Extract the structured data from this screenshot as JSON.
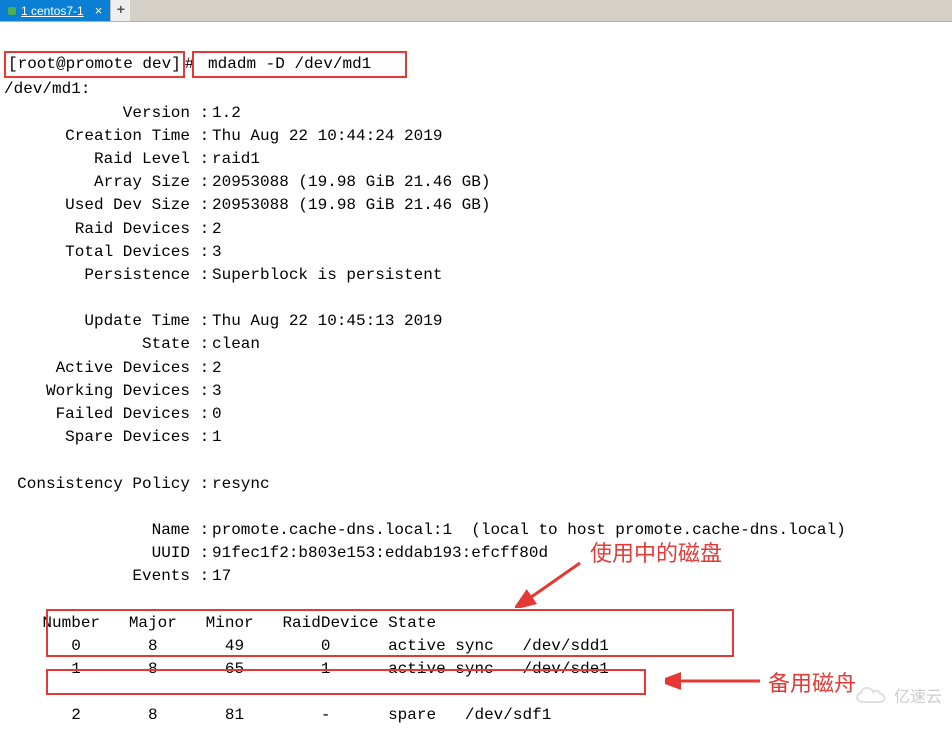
{
  "tab": {
    "label": "1 centos7-1",
    "close": "×",
    "add": "+"
  },
  "prompt": "[root@promote dev]",
  "hash": "#",
  "command": "mdadm -D /dev/md1",
  "device_line": "/dev/md1:",
  "info": {
    "version_k": "Version",
    "version_v": "1.2",
    "creation_time_k": "Creation Time",
    "creation_time_v": "Thu Aug 22 10:44:24 2019",
    "raid_level_k": "Raid Level",
    "raid_level_v": "raid1",
    "array_size_k": "Array Size",
    "array_size_v": "20953088 (19.98 GiB 21.46 GB)",
    "used_dev_size_k": "Used Dev Size",
    "used_dev_size_v": "20953088 (19.98 GiB 21.46 GB)",
    "raid_devices_k": "Raid Devices",
    "raid_devices_v": "2",
    "total_devices_k": "Total Devices",
    "total_devices_v": "3",
    "persistence_k": "Persistence",
    "persistence_v": "Superblock is persistent",
    "update_time_k": "Update Time",
    "update_time_v": "Thu Aug 22 10:45:13 2019",
    "state_k": "State",
    "state_v": "clean",
    "active_devices_k": "Active Devices",
    "active_devices_v": "2",
    "working_devices_k": "Working Devices",
    "working_devices_v": "3",
    "failed_devices_k": "Failed Devices",
    "failed_devices_v": "0",
    "spare_devices_k": "Spare Devices",
    "spare_devices_v": "1",
    "consistency_policy_k": "Consistency Policy",
    "consistency_policy_v": "resync",
    "name_k": "Name",
    "name_v": "promote.cache-dns.local:1  (local to host promote.cache-dns.local)",
    "uuid_k": "UUID",
    "uuid_v": "91fec1f2:b803e153:eddab193:efcff80d",
    "events_k": "Events",
    "events_v": "17"
  },
  "colon": " : ",
  "table_header": "    Number   Major   Minor   RaidDevice State",
  "rows": {
    "r0": "       0       8       49        0      active sync   /dev/sdd1",
    "r1": "       1       8       65        1      active sync   /dev/sde1",
    "r2": "       2       8       81        -      spare   /dev/sdf1"
  },
  "annotations": {
    "in_use": "使用中的磁盘",
    "spare": "备用磁舟"
  },
  "watermark": "亿速云"
}
